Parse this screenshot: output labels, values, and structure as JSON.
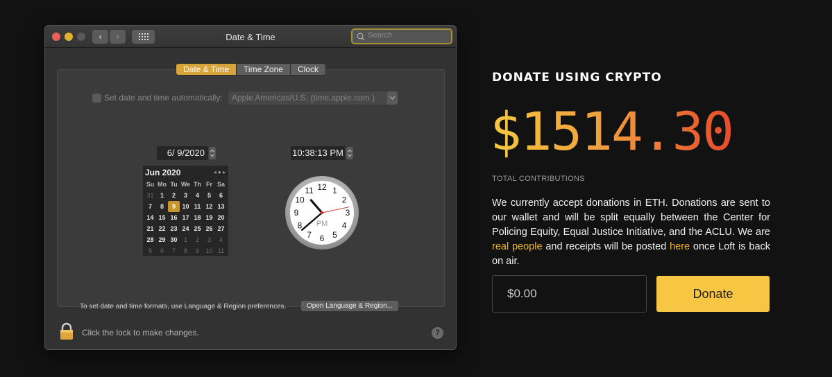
{
  "window": {
    "title": "Date & Time",
    "search_placeholder": "Search",
    "back_glyph": "‹",
    "forward_glyph": "›",
    "tabs": [
      "Date & Time",
      "Time Zone",
      "Clock"
    ],
    "active_tab": 0,
    "auto_label": "Set date and time automatically:",
    "time_server": "Apple Americas/U.S. (time.apple.com.)",
    "date_value": "6/  9/2020",
    "time_value": "10:38:13 PM",
    "calendar": {
      "month_year": "Jun 2020",
      "nav_glyphs": "◂ ● ▸",
      "weekdays": [
        "Su",
        "Mo",
        "Tu",
        "We",
        "Th",
        "Fr",
        "Sa"
      ],
      "days": [
        {
          "d": "31",
          "dim": true
        },
        {
          "d": "1"
        },
        {
          "d": "2"
        },
        {
          "d": "3"
        },
        {
          "d": "4"
        },
        {
          "d": "5"
        },
        {
          "d": "6"
        },
        {
          "d": "7"
        },
        {
          "d": "8"
        },
        {
          "d": "9",
          "sel": true
        },
        {
          "d": "10"
        },
        {
          "d": "11"
        },
        {
          "d": "12"
        },
        {
          "d": "13"
        },
        {
          "d": "14"
        },
        {
          "d": "15"
        },
        {
          "d": "16"
        },
        {
          "d": "17"
        },
        {
          "d": "18"
        },
        {
          "d": "19"
        },
        {
          "d": "20"
        },
        {
          "d": "21"
        },
        {
          "d": "22"
        },
        {
          "d": "23"
        },
        {
          "d": "24"
        },
        {
          "d": "25"
        },
        {
          "d": "26"
        },
        {
          "d": "27"
        },
        {
          "d": "28"
        },
        {
          "d": "29"
        },
        {
          "d": "30"
        },
        {
          "d": "1",
          "dim": true
        },
        {
          "d": "2",
          "dim": true
        },
        {
          "d": "3",
          "dim": true
        },
        {
          "d": "4",
          "dim": true
        },
        {
          "d": "5",
          "dim": true
        },
        {
          "d": "6",
          "dim": true
        },
        {
          "d": "7",
          "dim": true
        },
        {
          "d": "8",
          "dim": true
        },
        {
          "d": "9",
          "dim": true
        },
        {
          "d": "10",
          "dim": true
        },
        {
          "d": "11",
          "dim": true
        }
      ]
    },
    "clock": {
      "numbers": [
        "12",
        "1",
        "2",
        "3",
        "4",
        "5",
        "6",
        "7",
        "8",
        "9",
        "10",
        "11"
      ],
      "period": "PM",
      "hours": 10,
      "minutes": 38,
      "seconds": 13
    },
    "formats_text": "To set date and time formats, use Language & Region preferences.",
    "open_button": "Open Language & Region...",
    "lock_text": "Click the lock to make changes.",
    "help_glyph": "?"
  },
  "donate": {
    "title": "DONATE USING CRYPTO",
    "amount": "$1514.30",
    "total_label": "TOTAL CONTRIBUTIONS",
    "desc_1": "We currently accept donations in ETH. Donations are sent to our wallet and will be split equally between the Center for Policing Equity, Equal Justice Initiative, and the ACLU. We are ",
    "link_real_people": "real people",
    "desc_2": " and receipts will be posted ",
    "link_here": "here",
    "desc_3": " once Loft is back on air.",
    "input_placeholder": "$0.00",
    "button_label": "Donate",
    "accent_color": "#f7c744"
  }
}
